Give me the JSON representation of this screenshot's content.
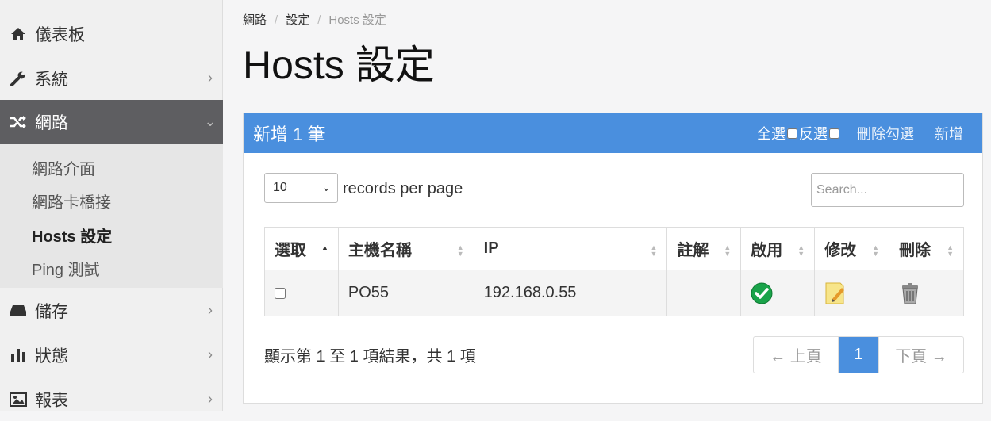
{
  "sidebar": {
    "items": [
      {
        "label": "儀表板",
        "icon": "home-icon"
      },
      {
        "label": "系統",
        "icon": "wrench-icon",
        "chevron": "›"
      },
      {
        "label": "網路",
        "icon": "shuffle-icon",
        "chevron": "⌄"
      },
      {
        "label": "儲存",
        "icon": "drive-icon",
        "chevron": "›"
      },
      {
        "label": "狀態",
        "icon": "bar-chart-icon",
        "chevron": "›"
      },
      {
        "label": "報表",
        "icon": "image-icon",
        "chevron": "›"
      }
    ],
    "sub_items": [
      "網路介面",
      "網路卡橋接",
      "Hosts 設定",
      "Ping 測試"
    ]
  },
  "breadcrumb": {
    "items": [
      "網路",
      "設定",
      "Hosts 設定"
    ]
  },
  "page_title": "Hosts 設定",
  "panel": {
    "title": "新增 1 筆",
    "select_all": "全選",
    "invert": "反選",
    "delete_checked": "刪除勾選",
    "add": "新增"
  },
  "table_controls": {
    "page_length": "10",
    "length_text": "records per page",
    "search_placeholder": "Search..."
  },
  "table": {
    "headers": [
      "選取",
      "主機名稱",
      "IP",
      "註解",
      "啟用",
      "修改",
      "刪除"
    ],
    "rows": [
      {
        "hostname": "PO55",
        "ip": "192.168.0.55",
        "note": ""
      }
    ]
  },
  "footer": {
    "info": "顯示第 1 至 1 項結果，共 1 項",
    "prev": "← 上頁",
    "page": "1",
    "next": "下頁 →"
  },
  "colors": {
    "accent": "#4a8fde",
    "active_nav": "#5e5e61"
  }
}
